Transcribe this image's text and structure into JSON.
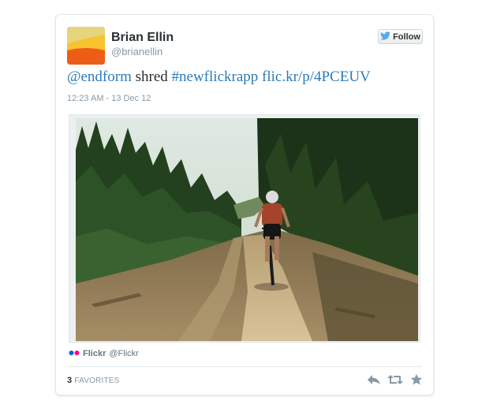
{
  "author": {
    "name": "Brian Ellin",
    "handle": "@brianellin"
  },
  "follow_button": {
    "label": "Follow",
    "icon": "twitter-bird-icon"
  },
  "tweet": {
    "mention": "@endform",
    "text": " shred ",
    "hashtag": "#newflickrapp",
    "space": " ",
    "link": "flic.kr/p/4PCEUV",
    "timestamp": "12:23 AM - 13 Dec 12"
  },
  "media": {
    "source_name": "Flickr",
    "source_handle": "@Flickr",
    "icon": "flickr-dots-icon"
  },
  "stats": {
    "favorites_count": "3",
    "favorites_label": "FAVORITES"
  },
  "actions": [
    {
      "name": "reply",
      "icon": "reply-icon"
    },
    {
      "name": "retweet",
      "icon": "retweet-icon"
    },
    {
      "name": "favorite",
      "icon": "star-icon"
    }
  ],
  "colors": {
    "link": "#2b7bb9",
    "text": "#292f33",
    "muted": "#8899a6",
    "avatar_orange": "#f26a1b",
    "avatar_yellow": "#f7c32e",
    "flickr_blue": "#0063dc",
    "flickr_pink": "#ff0084"
  }
}
